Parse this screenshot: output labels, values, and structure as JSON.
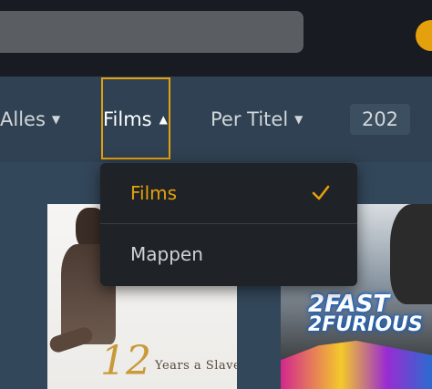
{
  "filters": {
    "type_label": "Alles",
    "section_label": "Films",
    "sort_label": "Per Titel",
    "count": "202"
  },
  "dropdown": {
    "items": [
      {
        "label": "Films",
        "selected": true
      },
      {
        "label": "Mappen",
        "selected": false
      }
    ]
  },
  "posters": [
    {
      "title_number": "12",
      "title_words": "Years a Slave"
    },
    {
      "title_line1": "2FAST",
      "title_line2": "2FURIOUS"
    }
  ],
  "colors": {
    "accent": "#e5a00d"
  }
}
